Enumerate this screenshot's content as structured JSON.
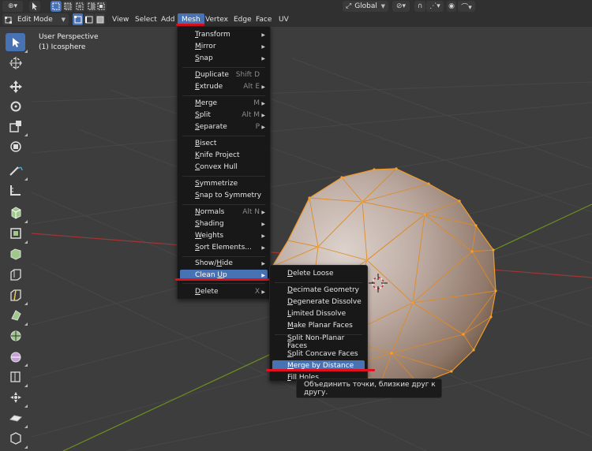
{
  "header": {
    "mode": {
      "label": "Edit Mode",
      "icon": "edit-mode-icon"
    },
    "menus": [
      "View",
      "Select",
      "Add",
      "Mesh",
      "Vertex",
      "Edge",
      "Face",
      "UV"
    ],
    "active_menu": "Mesh",
    "transform_orientation": "Global",
    "select_modes": [
      "vertex-select-icon",
      "edge-select-icon",
      "face-select-icon"
    ]
  },
  "viewport": {
    "view_name": "User Perspective",
    "object_name": "(1) Icosphere"
  },
  "mesh_menu": {
    "items": [
      {
        "label": "Transform",
        "shortcut": "",
        "submenu": true,
        "underline": "T"
      },
      {
        "label": "Mirror",
        "shortcut": "",
        "submenu": true,
        "underline": "M"
      },
      {
        "label": "Snap",
        "shortcut": "",
        "submenu": true,
        "underline": "S"
      },
      {
        "label": "Duplicate",
        "shortcut": "Shift D",
        "submenu": false,
        "underline": "D"
      },
      {
        "label": "Extrude",
        "shortcut": "Alt E",
        "submenu": true,
        "underline": "E"
      },
      {
        "label": "Merge",
        "shortcut": "M",
        "submenu": true,
        "underline": "M"
      },
      {
        "label": "Split",
        "shortcut": "Alt M",
        "submenu": true,
        "underline": "S"
      },
      {
        "label": "Separate",
        "shortcut": "P",
        "submenu": true,
        "underline": "S"
      },
      {
        "label": "Bisect",
        "shortcut": "",
        "submenu": false,
        "underline": "B"
      },
      {
        "label": "Knife Project",
        "shortcut": "",
        "submenu": false,
        "underline": "K"
      },
      {
        "label": "Convex Hull",
        "shortcut": "",
        "submenu": false,
        "underline": "C"
      },
      {
        "label": "Symmetrize",
        "shortcut": "",
        "submenu": false,
        "underline": "S"
      },
      {
        "label": "Snap to Symmetry",
        "shortcut": "",
        "submenu": false,
        "underline": "S"
      },
      {
        "label": "Normals",
        "shortcut": "Alt N",
        "submenu": true,
        "underline": "N"
      },
      {
        "label": "Shading",
        "shortcut": "",
        "submenu": true,
        "underline": "S"
      },
      {
        "label": "Weights",
        "shortcut": "",
        "submenu": true,
        "underline": "W"
      },
      {
        "label": "Sort Elements...",
        "shortcut": "",
        "submenu": true,
        "underline": "S"
      },
      {
        "label": "Show/Hide",
        "shortcut": "",
        "submenu": true,
        "underline": "H"
      },
      {
        "label": "Clean Up",
        "shortcut": "",
        "submenu": true,
        "underline": "U"
      },
      {
        "label": "Delete",
        "shortcut": "X",
        "submenu": true,
        "underline": "D"
      }
    ],
    "highlighted": "Clean Up"
  },
  "cleanup_menu": {
    "items": [
      {
        "label": "Delete Loose",
        "underline": "D"
      },
      {
        "label": "Decimate Geometry",
        "underline": "D"
      },
      {
        "label": "Degenerate Dissolve",
        "underline": "D"
      },
      {
        "label": "Limited Dissolve",
        "underline": "L"
      },
      {
        "label": "Make Planar Faces",
        "underline": "M"
      },
      {
        "label": "Split Non-Planar Faces",
        "underline": "S"
      },
      {
        "label": "Split Concave Faces",
        "underline": "S"
      },
      {
        "label": "Merge by Distance",
        "underline": "M"
      },
      {
        "label": "Fill Holes",
        "underline": "F"
      }
    ],
    "highlighted": "Merge by Distance"
  },
  "tooltip": {
    "text": "Объединить точки, близкие друг к другу."
  },
  "tools": [
    "select-box-icon",
    "cursor-icon",
    "move-icon",
    "rotate-icon",
    "scale-icon",
    "transform-icon",
    "annotate-icon",
    "measure-icon",
    "add-cube-icon",
    "extrude-region-icon",
    "inset-faces-icon",
    "bevel-icon",
    "loop-cut-icon",
    "knife-icon",
    "poly-build-icon",
    "spin-icon",
    "smooth-icon",
    "edge-slide-icon",
    "shrink-fatten-icon",
    "shear-icon",
    "rip-region-icon"
  ],
  "colors": {
    "accent": "#4772b3",
    "menu_bg": "#181818",
    "header_bg": "#303030",
    "viewport_bg": "#3d3d3d",
    "mesh_edge": "#f09a2a",
    "axis_x": "#a33535",
    "axis_y": "#6b8f1f",
    "annotation_red": "#e0101e"
  }
}
